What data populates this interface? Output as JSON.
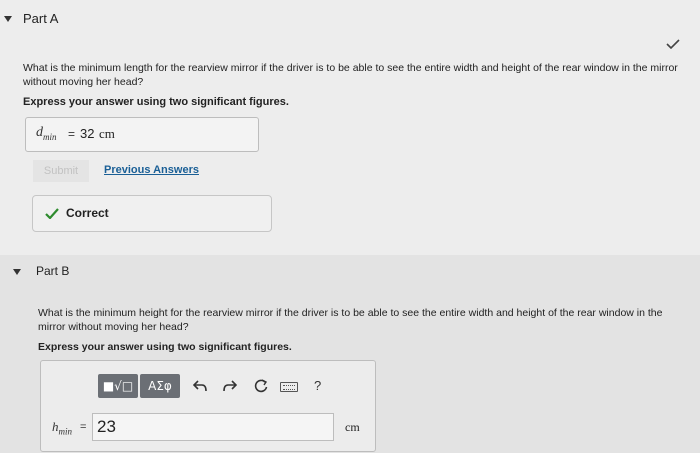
{
  "partA": {
    "title": "Part A",
    "question": "What is the minimum length for the rearview mirror if the driver is to be able to see the entire width and height of the rear window in the mirror without moving her head?",
    "instruction": "Express your answer using two significant figures.",
    "answer": {
      "variable": "d",
      "subscript": "min",
      "equals": "=",
      "value": "32",
      "unit": "cm"
    },
    "submit_label": "Submit",
    "previous_answers_label": "Previous Answers",
    "feedback": "Correct"
  },
  "partB": {
    "title": "Part B",
    "question": "What is the minimum height for the rearview mirror if the driver is to be able to see the entire width and height of the rear window in the mirror without moving her head?",
    "instruction": "Express your answer using two significant figures.",
    "toolbar": {
      "matrix_label": "■√□",
      "greek_label": "ΑΣφ",
      "undo_icon": "undo-icon",
      "redo_icon": "redo-icon",
      "reset_icon": "reset-icon",
      "keyboard_icon": "keyboard-icon",
      "help_label": "?"
    },
    "answer": {
      "variable": "h",
      "subscript": "min",
      "equals": "=",
      "input_value": "23",
      "unit": "cm"
    }
  },
  "colors": {
    "link": "#1a5f96",
    "correct_check": "#2e8b2e",
    "toolbar_button": "#6b6f75"
  }
}
